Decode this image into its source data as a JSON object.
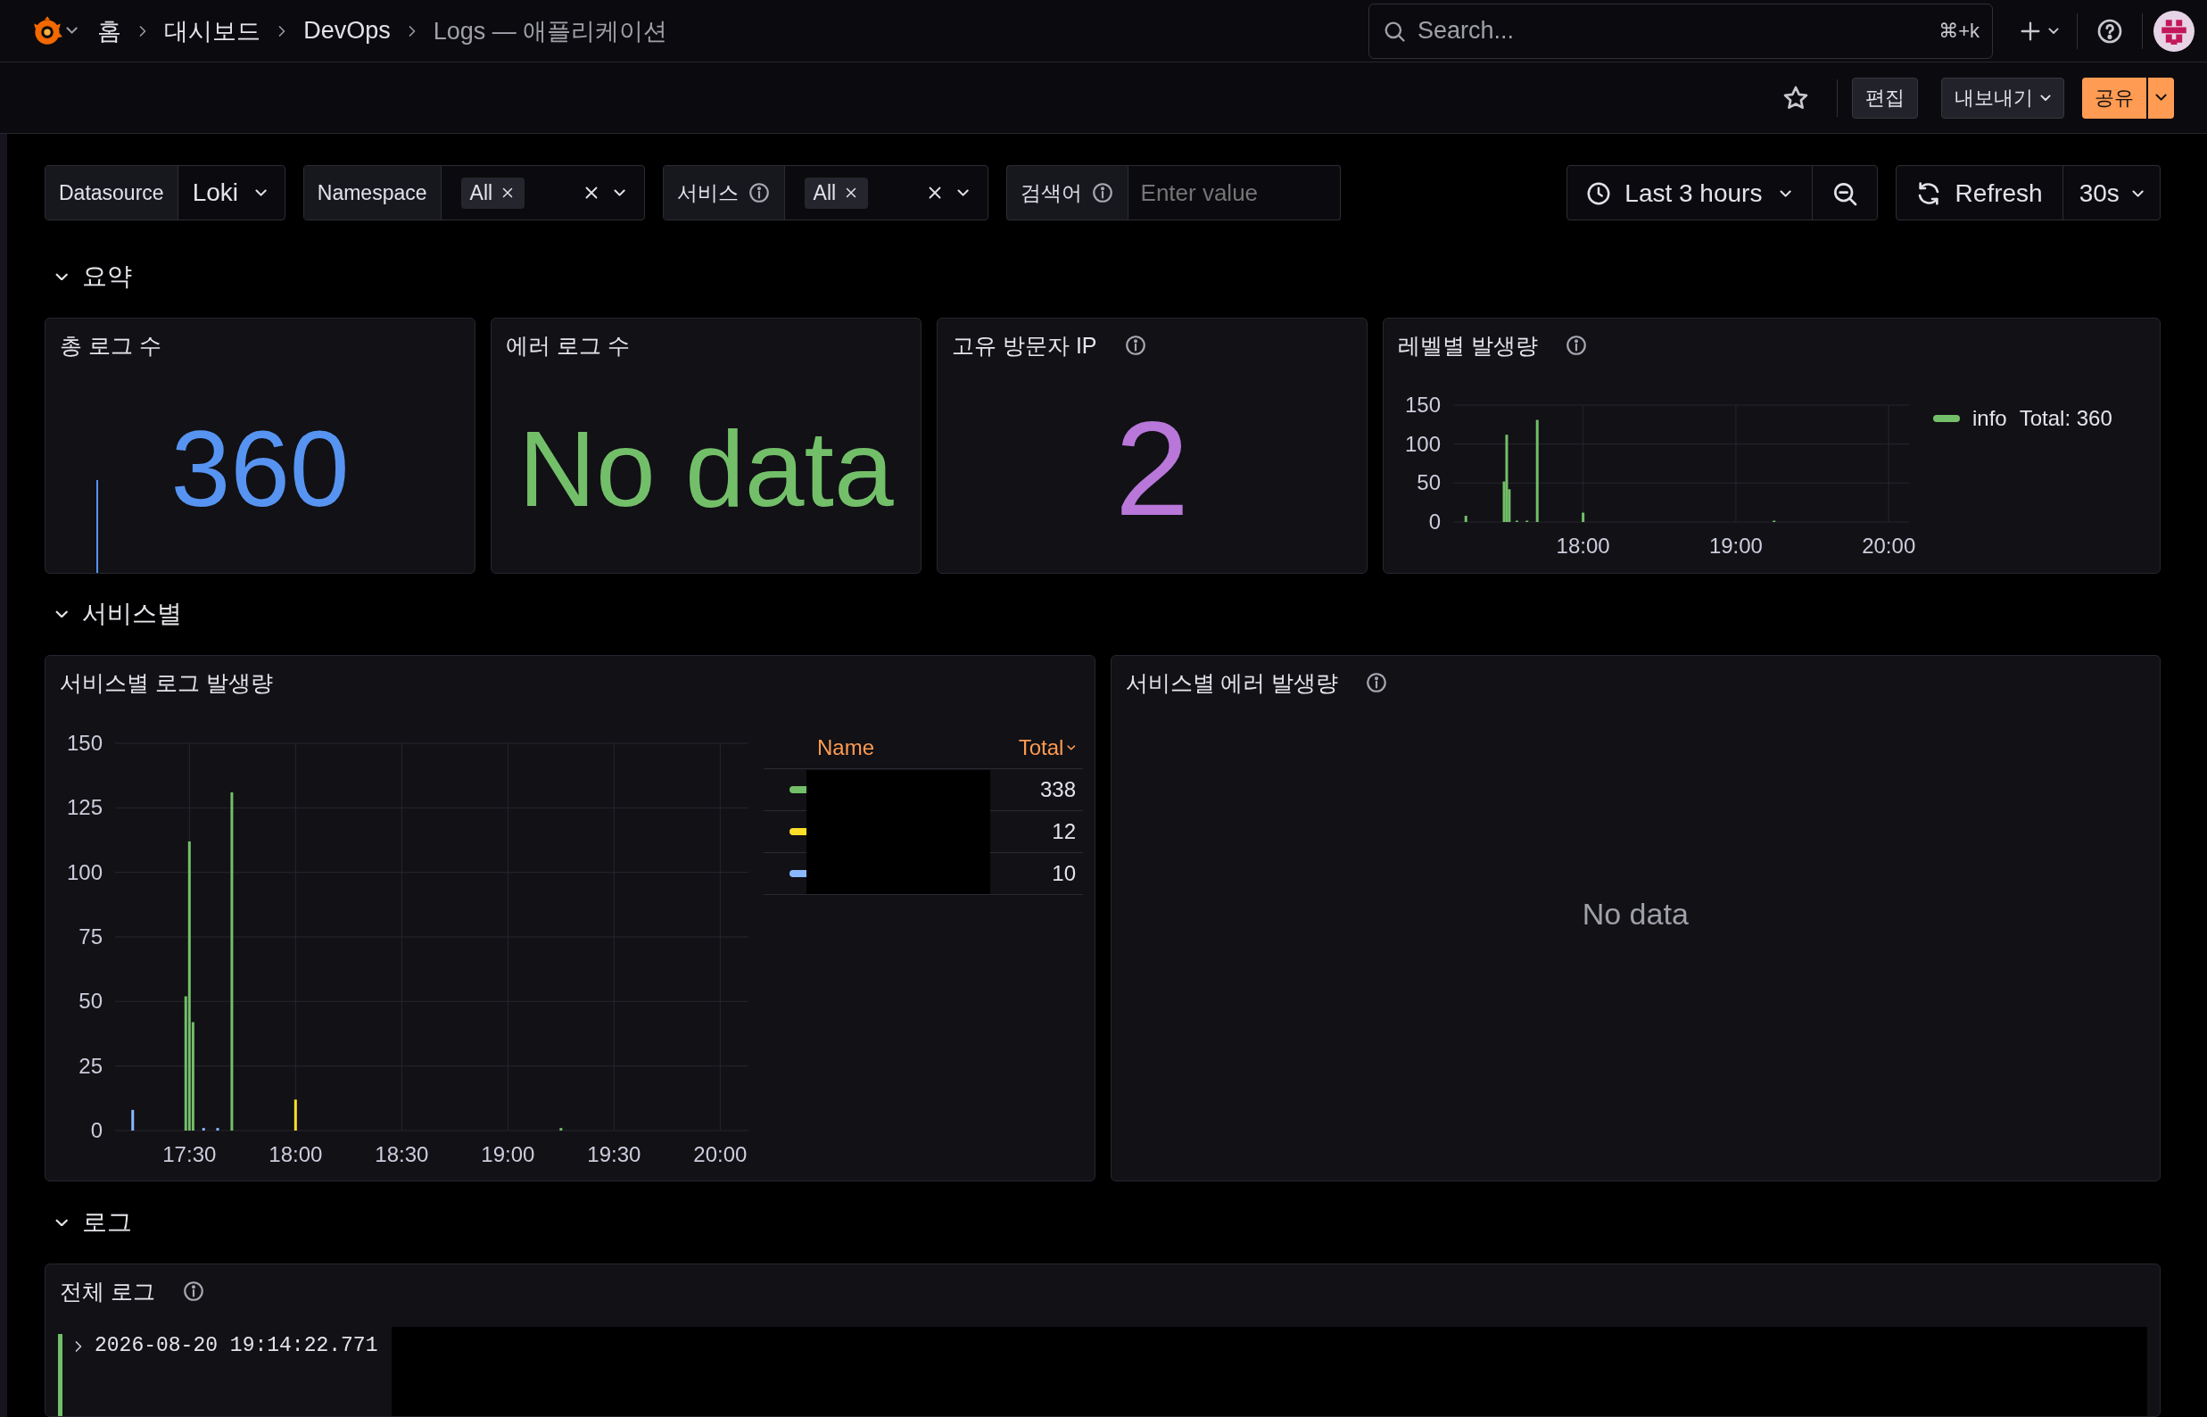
{
  "topbar": {
    "breadcrumbs": [
      {
        "label": "홈",
        "current": false
      },
      {
        "label": "대시보드",
        "current": false
      },
      {
        "label": "DevOps",
        "current": false
      },
      {
        "label": "Logs — 애플리케이션",
        "current": true
      }
    ],
    "search": {
      "placeholder": "Search...",
      "shortcut": "⌘+k"
    }
  },
  "toolbar": {
    "starred": false,
    "buttons": [
      {
        "label": "편집",
        "kind": "plain"
      },
      {
        "label": "내보내기",
        "kind": "dropdown"
      },
      {
        "label": "공유",
        "kind": "primary-split"
      }
    ]
  },
  "variables": [
    {
      "label": "Datasource",
      "info": false,
      "kind": "select",
      "value": "Loki"
    },
    {
      "label": "Namespace",
      "info": false,
      "kind": "multi",
      "chips": [
        "All"
      ]
    },
    {
      "label": "서비스",
      "info": true,
      "kind": "multi",
      "chips": [
        "All"
      ]
    },
    {
      "label": "검색어",
      "info": true,
      "kind": "text",
      "placeholder": "Enter value"
    }
  ],
  "time_picker": {
    "range": "Last 3 hours"
  },
  "refresh": {
    "label": "Refresh",
    "interval": "30s"
  },
  "sections": [
    {
      "title": "요약",
      "expanded": true,
      "panels": [
        {
          "kind": "stat",
          "title": "총 로그 수",
          "info": false,
          "value": "360",
          "color": "#5794f2",
          "sparkline": true
        },
        {
          "kind": "stat",
          "title": "에러 로그 수",
          "info": false,
          "value": "No data",
          "color": "#73bf69"
        },
        {
          "kind": "stat",
          "title": "고유 방문자 IP",
          "info": true,
          "value": "2",
          "color": "#b877d9"
        },
        {
          "kind": "timeseries",
          "title": "레벨별 발생량",
          "info": true,
          "chart_data": {
            "type": "bar",
            "grid": true,
            "x": [
              17.233,
              17.483,
              17.5,
              17.517,
              17.567,
              17.633,
              17.7,
              18,
              19.25
            ],
            "xlim": [
              17.15,
              20.133
            ],
            "ylim": [
              0,
              150
            ],
            "yticks": [
              0,
              50,
              100,
              150
            ],
            "xticks": [
              {
                "value": 18,
                "label": "18:00"
              },
              {
                "value": 19,
                "label": "19:00"
              },
              {
                "value": 20,
                "label": "20:00"
              }
            ],
            "series": [
              {
                "name": "info",
                "color": "#73bf69",
                "values": [
                  8,
                  52,
                  112,
                  42,
                  1,
                  1,
                  131,
                  12,
                  1
                ]
              }
            ]
          },
          "legend": {
            "kind": "list",
            "items": [
              {
                "total": "Total: 360"
              }
            ]
          }
        }
      ]
    },
    {
      "title": "서비스별",
      "expanded": true,
      "panels": [
        {
          "kind": "timeseries",
          "title": "서비스별 로그 발생량",
          "info": false,
          "chart_data": {
            "type": "bar",
            "grid": true,
            "x": [
              17.233,
              17.483,
              17.5,
              17.517,
              17.567,
              17.633,
              17.7,
              18,
              19.25
            ],
            "xlim": [
              17.15,
              20.133
            ],
            "ylim": [
              0,
              150
            ],
            "yticks": [
              0,
              25,
              50,
              75,
              100,
              125,
              150
            ],
            "xticks": [
              {
                "value": 17.5,
                "label": "17:30"
              },
              {
                "value": 18,
                "label": "18:00"
              },
              {
                "value": 18.5,
                "label": "18:30"
              },
              {
                "value": 19,
                "label": "19:00"
              },
              {
                "value": 19.5,
                "label": "19:30"
              },
              {
                "value": 20,
                "label": "20:00"
              }
            ],
            "series": [
              {
                "color": "#73bf69",
                "values": [
                  null,
                  52,
                  112,
                  42,
                  null,
                  null,
                  131,
                  null,
                  1
                ]
              },
              {
                "color": "#fade2a",
                "values": [
                  null,
                  null,
                  null,
                  null,
                  null,
                  null,
                  null,
                  12,
                  null
                ]
              },
              {
                "color": "#8ab8ff",
                "values": [
                  8,
                  null,
                  null,
                  null,
                  1,
                  1,
                  null,
                  null,
                  null
                ]
              }
            ]
          },
          "legend": {
            "kind": "table",
            "name_header": "Name",
            "total_header": "Total",
            "sort_descending": true,
            "redacted": true,
            "items": [
              {
                "total": "338"
              },
              {
                "total": "12"
              },
              {
                "total": "10"
              }
            ]
          }
        },
        {
          "kind": "nodata",
          "title": "서비스별 에러 발생량",
          "info": true,
          "message": "No data"
        }
      ]
    },
    {
      "title": "로그",
      "expanded": true,
      "panels": [
        {
          "kind": "logs",
          "title": "전체 로그",
          "info": true,
          "rows": [
            {
              "timestamp": "2026-08-20 19:14:22.771",
              "color": "#73bf69",
              "expanded": false,
              "redacted": true
            }
          ]
        }
      ]
    }
  ]
}
